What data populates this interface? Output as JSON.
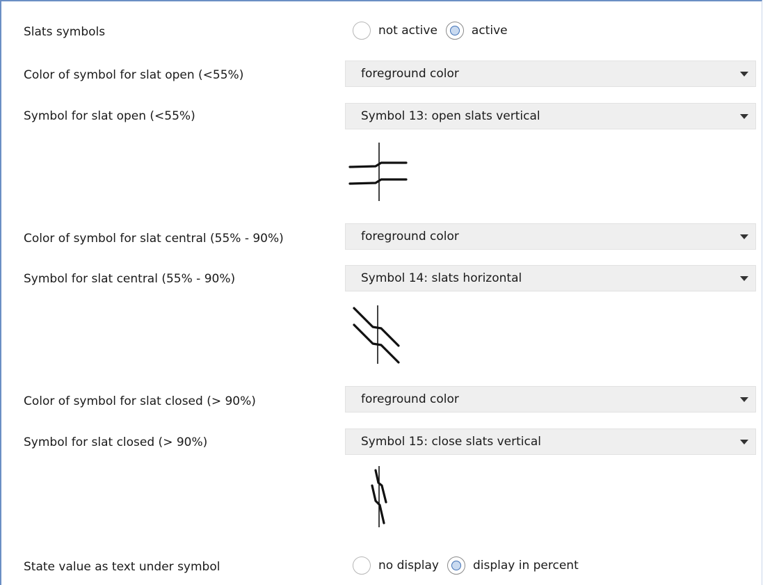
{
  "slats_symbols": {
    "label": "Slats symbols",
    "options": [
      "not active",
      "active"
    ],
    "selected": "active"
  },
  "open": {
    "color_label": "Color of symbol for slat open (<55%)",
    "color_value": "foreground color",
    "symbol_label": "Symbol for slat open (<55%)",
    "symbol_value": "Symbol 13: open slats vertical",
    "symbol_icon": "open-slats-vertical-icon"
  },
  "central": {
    "color_label": "Color of symbol for slat central (55% - 90%)",
    "color_value": "foreground color",
    "symbol_label": "Symbol for slat central (55% - 90%)",
    "symbol_value": "Symbol 14: slats horizontal",
    "symbol_icon": "slats-horizontal-icon"
  },
  "closed": {
    "color_label": "Color of symbol for slat closed (> 90%)",
    "color_value": "foreground color",
    "symbol_label": "Symbol for slat closed (> 90%)",
    "symbol_value": "Symbol 15: close slats vertical",
    "symbol_icon": "close-slats-vertical-icon"
  },
  "state_value": {
    "label": "State value as text under symbol",
    "options": [
      "no display",
      "display in percent"
    ],
    "selected": "display in percent"
  },
  "colors": {
    "frame_border": "#6b8fc4",
    "dropdown_bg": "#efefef",
    "radio_checked_ring": "#3f70b5"
  }
}
